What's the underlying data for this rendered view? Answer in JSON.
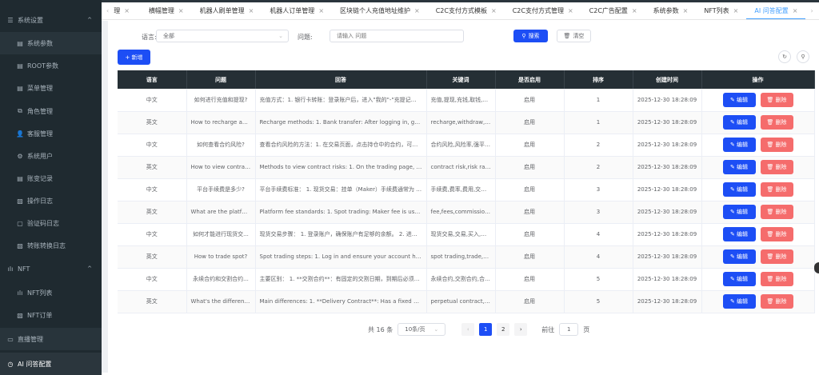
{
  "sidebar": {
    "items": [
      {
        "label": "系统设置",
        "icon": "menu-icon",
        "type": "top"
      },
      {
        "label": "系统参数",
        "icon": "doc-icon",
        "type": "sub"
      },
      {
        "label": "ROOT参数",
        "icon": "doc-icon",
        "type": "sub"
      },
      {
        "label": "菜单管理",
        "icon": "doc-icon",
        "type": "sub"
      },
      {
        "label": "角色管理",
        "icon": "role-icon",
        "type": "sub"
      },
      {
        "label": "客服管理",
        "icon": "user-icon",
        "type": "sub"
      },
      {
        "label": "系统用户",
        "icon": "gear-icon",
        "type": "sub"
      },
      {
        "label": "账变记录",
        "icon": "doc-icon",
        "type": "sub"
      },
      {
        "label": "操作日志",
        "icon": "log-icon",
        "type": "sub"
      },
      {
        "label": "验证码日志",
        "icon": "file-icon",
        "type": "sub"
      },
      {
        "label": "转账转换日志",
        "icon": "log-icon",
        "type": "sub"
      },
      {
        "label": "NFT",
        "icon": "chart-icon",
        "type": "top"
      },
      {
        "label": "NFT列表",
        "icon": "chart-icon",
        "type": "sub"
      },
      {
        "label": "NFT订单",
        "icon": "log-icon",
        "type": "sub"
      },
      {
        "label": "直播管理",
        "icon": "video-icon",
        "type": "top"
      },
      {
        "label": "AI 问答配置",
        "icon": "clock-icon",
        "type": "top"
      }
    ]
  },
  "tabs": [
    "理",
    "横幅管理",
    "机器人刷单管理",
    "机器人订单管理",
    "区块链个人充值地址维护",
    "C2C支付方式模板",
    "C2C支付方式管理",
    "C2C广告配置",
    "系统参数",
    "NFT列表",
    "AI 问答配置"
  ],
  "filters": {
    "language_label": "语言:",
    "language_value": "全部",
    "question_label": "问题:",
    "question_placeholder": "请输入 问题",
    "search": "搜索",
    "clear": "清空"
  },
  "add_button": "+ 新增",
  "table": {
    "headers": [
      "语言",
      "问题",
      "回答",
      "关键词",
      "是否启用",
      "排序",
      "创建时间",
      "操作"
    ],
    "edit": "编辑",
    "delete": "删除",
    "rows": [
      [
        "中文",
        "如何进行充值和提现?",
        "充值方式：1. 银行卡转账：登录账户后，进入\"我的\"-\"充提记录\"，...",
        "充值,提现,充钱,取钱,...",
        "启用",
        "1",
        "2025-12-30 18:28:09"
      ],
      [
        "英文",
        "How to recharge and ...",
        "Recharge methods: 1. Bank transfer: After logging in, go to \"My\" -...",
        "recharge,withdraw,de...",
        "启用",
        "1",
        "2025-12-30 18:28:09"
      ],
      [
        "中文",
        "如何查看合约风险?",
        "查看合约风险的方法：1. 在交易页面，点击持仓中的合约，可以...",
        "合约风险,风险率,强平,...",
        "启用",
        "2",
        "2025-12-30 18:28:09"
      ],
      [
        "英文",
        "How to view contract r...",
        "Methods to view contract risks: 1. On the trading page, click on a ...",
        "contract risk,risk rate,l...",
        "启用",
        "2",
        "2025-12-30 18:28:09"
      ],
      [
        "中文",
        "平台手续费是多少?",
        "平台手续费标准： 1. 现货交易：挂单（Maker）手续费通常为 0.1...",
        "手续费,费率,费用,交易...",
        "启用",
        "3",
        "2025-12-30 18:28:09"
      ],
      [
        "英文",
        "What are the platform ...",
        "Platform fee standards: 1. Spot trading: Maker fee is usually 0.1...",
        "fee,fees,commission,t...",
        "启用",
        "3",
        "2025-12-30 18:28:09"
      ],
      [
        "中文",
        "如何才能进行现货交...",
        "现货交易步骤： 1. 登录账户，确保账户有足够的余额。 2. 进入\"...",
        "现货交易,交易,买入,卖...",
        "启用",
        "4",
        "2025-12-30 18:28:09"
      ],
      [
        "英文",
        "How to trade spot?",
        "Spot trading steps: 1. Log in and ensure your account has sufficie...",
        "spot trading,trade,buy,...",
        "启用",
        "4",
        "2025-12-30 18:28:09"
      ],
      [
        "中文",
        "永续合约和交割合约...",
        "主要区别： 1. **交割合约**：有固定的交割日期，到期后必须交割...",
        "永续合约,交割合约,合...",
        "启用",
        "5",
        "2025-12-30 18:28:09"
      ],
      [
        "英文",
        "What's the difference ...",
        "Main differences: 1. **Delivery Contract**: Has a fixed delivery da...",
        "perpetual contract,deli...",
        "启用",
        "5",
        "2025-12-30 18:28:09"
      ]
    ]
  },
  "pagination": {
    "total": "共 16 条",
    "page_size": "10条/页",
    "pages": [
      "1",
      "2"
    ],
    "current": "1",
    "goto_label": "前往",
    "goto_value": "1",
    "page_suffix": "页"
  },
  "colors": {
    "sidebar": "#1f2a30",
    "primary": "#1d4ef5",
    "danger": "#f56c6c",
    "header": "#252f35"
  }
}
